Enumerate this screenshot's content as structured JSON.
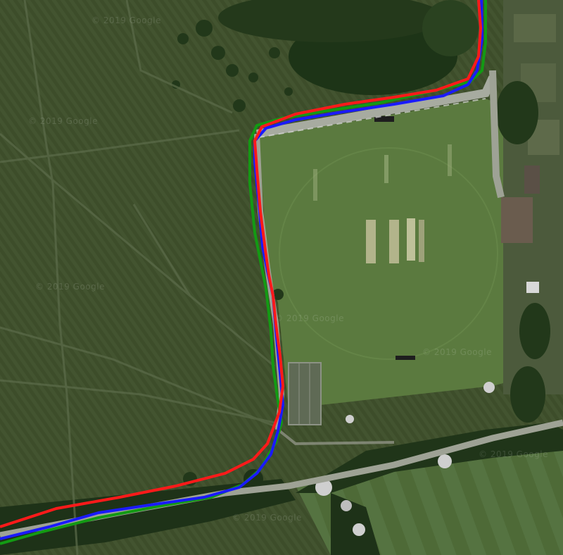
{
  "map": {
    "watermark_text": "© 2019 Google",
    "track_colors": {
      "red": "#ff1a1a",
      "blue": "#1a1aff",
      "green": "#139a13"
    },
    "surface_colors": {
      "grass_dark": "#3b4b28",
      "grass_field": "#5c7440",
      "trees": "#1f3318",
      "path": "#9a9e92"
    }
  }
}
